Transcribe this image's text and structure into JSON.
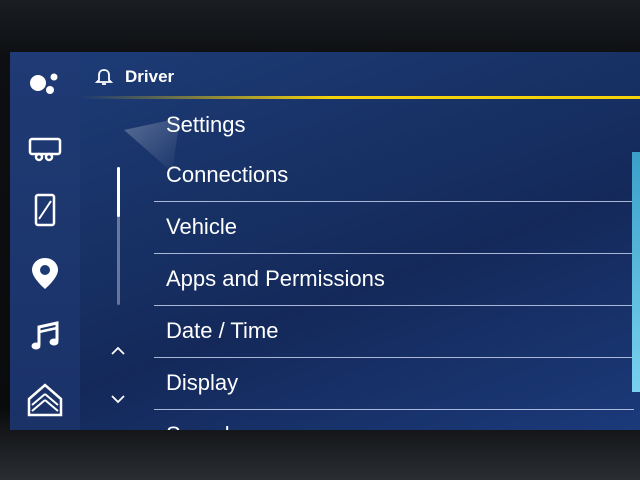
{
  "header": {
    "profile_label": "Driver"
  },
  "menu": {
    "title": "Settings",
    "items": [
      {
        "label": "Connections"
      },
      {
        "label": "Vehicle"
      },
      {
        "label": "Apps and Permissions"
      },
      {
        "label": "Date / Time"
      },
      {
        "label": "Display"
      },
      {
        "label": "Sounds"
      }
    ]
  },
  "sidebar": {
    "items": [
      {
        "icon": "assistant-icon"
      },
      {
        "icon": "trailer-icon"
      },
      {
        "icon": "phone-icon"
      },
      {
        "icon": "location-pin-icon"
      },
      {
        "icon": "music-note-icon"
      },
      {
        "icon": "home-icon"
      }
    ]
  },
  "colors": {
    "accent": "#f5d20a",
    "background": "#183266",
    "divider": "#dce6ff"
  }
}
